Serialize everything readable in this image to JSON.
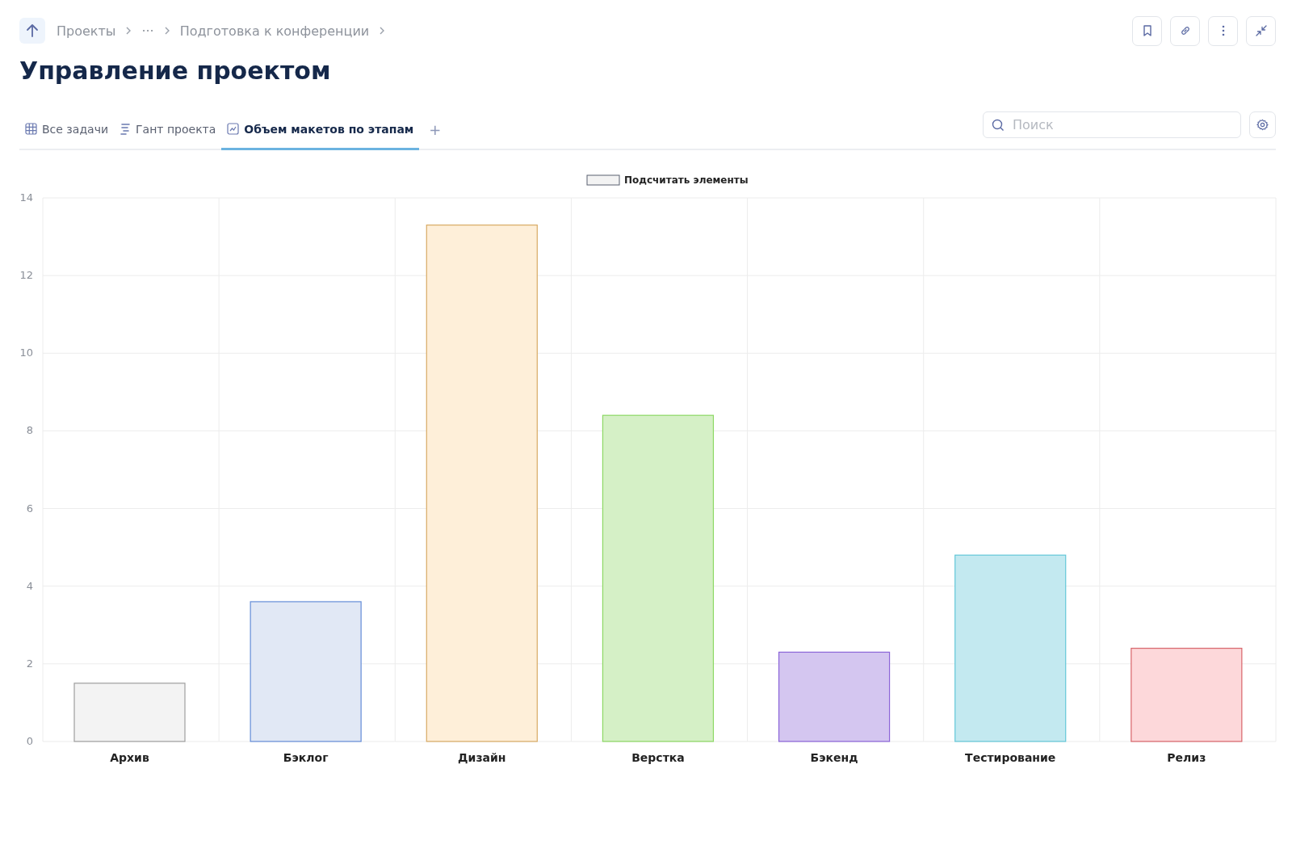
{
  "breadcrumb": {
    "items": [
      "Проекты",
      "···",
      "Подготовка к конференции"
    ]
  },
  "title": "Управление проектом",
  "tabs": [
    {
      "label": "Все задачи",
      "selected": false
    },
    {
      "label": "Гант проекта",
      "selected": false
    },
    {
      "label": "Объем макетов по этапам",
      "selected": true
    }
  ],
  "add_tab": "+",
  "search": {
    "placeholder": "Поиск"
  },
  "chart_data": {
    "type": "bar",
    "categories": [
      "Архив",
      "Бэклог",
      "Дизайн",
      "Верстка",
      "Бэкенд",
      "Тестирование",
      "Релиз"
    ],
    "series": [
      {
        "name": "Подсчитать элементы",
        "color": [
          "#f3f3f3",
          "#e1e8f5",
          "#feefd9",
          "#d5f0c6",
          "#d4c6f0",
          "#c3e9f0",
          "#fdd8da"
        ],
        "values": [
          1.5,
          3.6,
          13.3,
          8.4,
          2.3,
          4.8,
          2.4
        ]
      }
    ],
    "ylim": [
      0,
      14
    ],
    "yticks": [
      0,
      2,
      4,
      6,
      8,
      10,
      12,
      14
    ],
    "grid": true
  }
}
